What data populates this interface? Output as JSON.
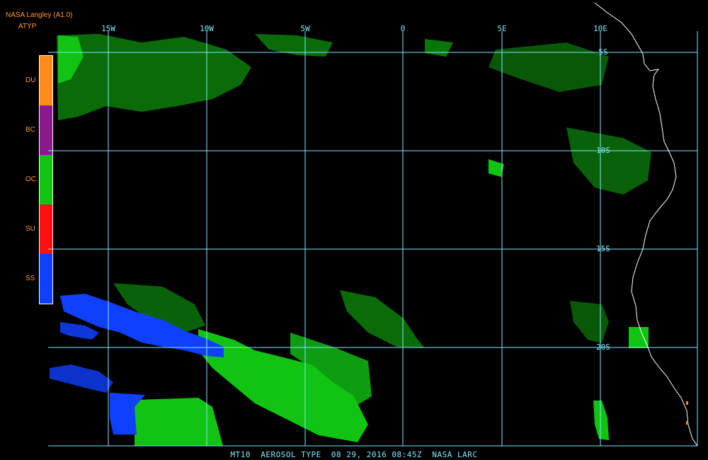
{
  "header": {
    "title": "NASA Langley (A1.0)",
    "product": "ATYP"
  },
  "legend": [
    {
      "label": "DU",
      "color": "#ff8c1a"
    },
    {
      "label": "BC",
      "color": "#8a1a8a"
    },
    {
      "label": "OC",
      "color": "#11c411"
    },
    {
      "label": "SU",
      "color": "#ff1010"
    },
    {
      "label": "SS",
      "color": "#1040ff"
    }
  ],
  "grid": {
    "color": "#7fe8ff",
    "lon_labels": [
      "15W",
      "10W",
      "5W",
      "0",
      "5E",
      "10E"
    ],
    "lat_labels": [
      "5S",
      "10S",
      "15S",
      "20S"
    ]
  },
  "footer": {
    "text": "MT10  AEROSOL TYPE  08 29, 2016 08:45Z  NASA LARC"
  },
  "colors": {
    "background": "#000000",
    "coastline": "#ffffff",
    "organic_carbon": "#11c411",
    "sea_salt": "#1040ff",
    "label": "#ff9a2e"
  }
}
